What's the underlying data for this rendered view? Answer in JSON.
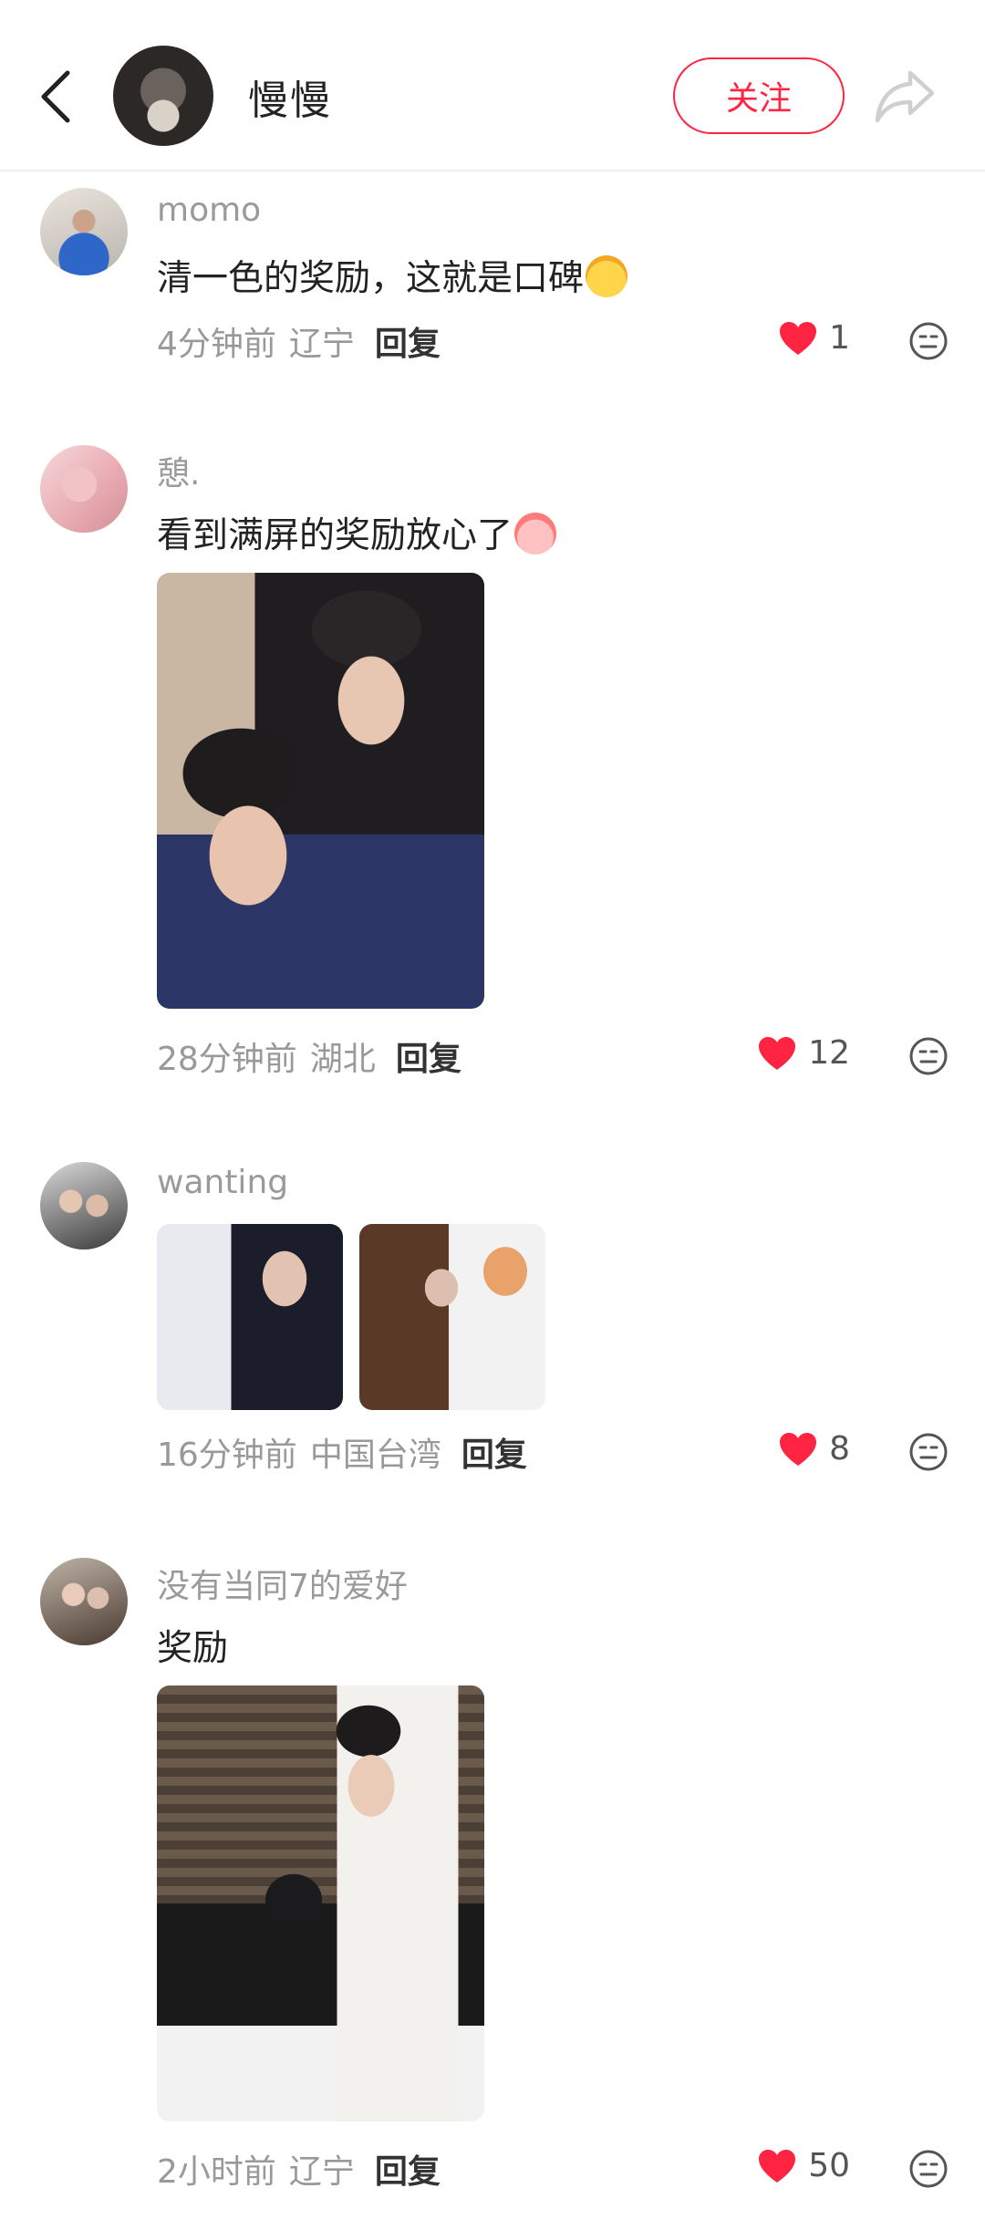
{
  "header": {
    "author_name": "慢慢",
    "follow_label": "关注"
  },
  "colors": {
    "accent": "#ff2442",
    "like_heart": "#ff2442",
    "meta_gray": "#999999"
  },
  "comments": [
    {
      "username": "momo",
      "text": "清一色的奖励，这就是口碑",
      "time": "4分钟前",
      "location": "辽宁",
      "reply_label": "回复",
      "likes": "1"
    },
    {
      "username": "憩.",
      "text": "看到满屏的奖励放心了",
      "time": "28分钟前",
      "location": "湖北",
      "reply_label": "回复",
      "likes": "12"
    },
    {
      "username": "wanting",
      "text": "",
      "time": "16分钟前",
      "location": "中国台湾",
      "reply_label": "回复",
      "likes": "8"
    },
    {
      "username": "没有当同7的爱好",
      "text": "奖励",
      "time": "2小时前",
      "location": "辽宁",
      "reply_label": "回复",
      "likes": "50"
    }
  ]
}
